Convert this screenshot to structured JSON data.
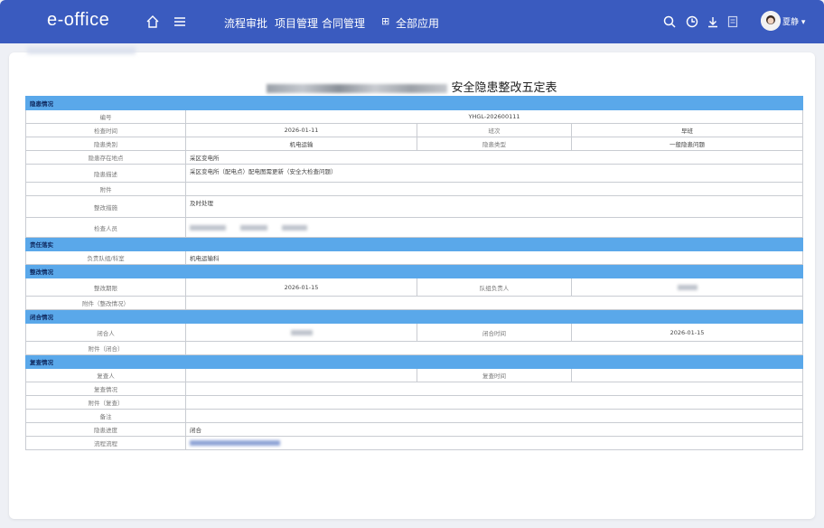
{
  "app": {
    "logo": "e-office",
    "user_name": "夏静"
  },
  "nav": {
    "items": [
      "流程审批",
      "项目管理",
      "合同管理"
    ],
    "all_apps": "全部应用"
  },
  "form": {
    "title": "安全隐患整改五定表",
    "sections": {
      "s1": "隐患情况",
      "s2": "责任落实",
      "s3": "整改情况",
      "s4": "闭合情况",
      "s5": "复查情况"
    },
    "labels": {
      "number": "编号",
      "check_time": "检查时间",
      "shift": "班次",
      "category": "隐患类别",
      "level": "隐患类型",
      "location": "隐患存在地点",
      "desc": "隐患描述",
      "attach": "附件",
      "measure": "整改措施",
      "inspector": "检查人员",
      "resp_unit": "负责队组/科室",
      "deadline": "整改期限",
      "team_lead": "队组负责人",
      "attach_rect": "附件（整改情况）",
      "closer": "闭合人",
      "close_time": "闭合时间",
      "attach_close": "附件（闭合）",
      "rechecker": "复查人",
      "recheck_time": "复查时间",
      "recheck_status": "复查情况",
      "attach_recheck": "附件（复查）",
      "remark": "备注",
      "progress": "隐患进度",
      "flow": "流程流程"
    },
    "values": {
      "number": "YHGL-202600111",
      "check_time": "2026-01-11",
      "shift": "早班",
      "category": "机电运输",
      "level": "一般隐患问题",
      "location": "采区变电所",
      "desc": "采区变电所（配电点）配电图需更新（安全大检查问题）",
      "measure": "及时处理",
      "resp_unit": "机电运输科",
      "deadline": "2026-01-15",
      "close_time": "2026-01-15",
      "progress": "闭合"
    }
  }
}
